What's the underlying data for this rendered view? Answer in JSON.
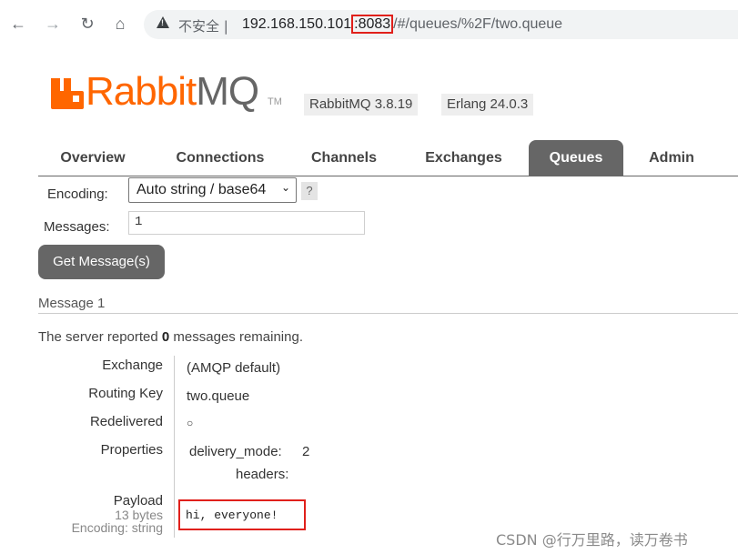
{
  "browser": {
    "insecure_label": "不安全",
    "url_host": "192.168.150.101",
    "url_port": ":8083",
    "url_path": "/#/queues/%2F/two.queue"
  },
  "header": {
    "logo_rabbit": "Rabbit",
    "logo_mq": "MQ",
    "logo_tm": "TM",
    "rabbitmq_version": "RabbitMQ 3.8.19",
    "erlang_version": "Erlang 24.0.3"
  },
  "tabs": [
    {
      "label": "Overview",
      "active": false
    },
    {
      "label": "Connections",
      "active": false
    },
    {
      "label": "Channels",
      "active": false
    },
    {
      "label": "Exchanges",
      "active": false
    },
    {
      "label": "Queues",
      "active": true
    },
    {
      "label": "Admin",
      "active": false
    }
  ],
  "form": {
    "encoding_label": "Encoding:",
    "encoding_value": "Auto string / base64",
    "help_label": "?",
    "messages_label": "Messages:",
    "messages_value": "1",
    "get_button": "Get Message(s)"
  },
  "result": {
    "heading": "Message 1",
    "note_prefix": "The server reported ",
    "note_count": "0",
    "note_suffix": " messages remaining.",
    "rows": {
      "exchange_label": "Exchange",
      "exchange_value": "(AMQP default)",
      "routing_key_label": "Routing Key",
      "routing_key_value": "two.queue",
      "redelivered_label": "Redelivered",
      "redelivered_value": "○",
      "properties_label": "Properties",
      "delivery_mode_key": "delivery_mode:",
      "delivery_mode_value": "2",
      "headers_key": "headers:",
      "payload_label": "Payload",
      "payload_size": "13 bytes",
      "payload_encoding": "Encoding: string",
      "payload_value": "hi, everyone!"
    }
  },
  "watermark": "CSDN @行万里路，读万卷书",
  "colors": {
    "brand": "#ff6600",
    "tab_active_bg": "#666666",
    "highlight": "#e0201b"
  }
}
